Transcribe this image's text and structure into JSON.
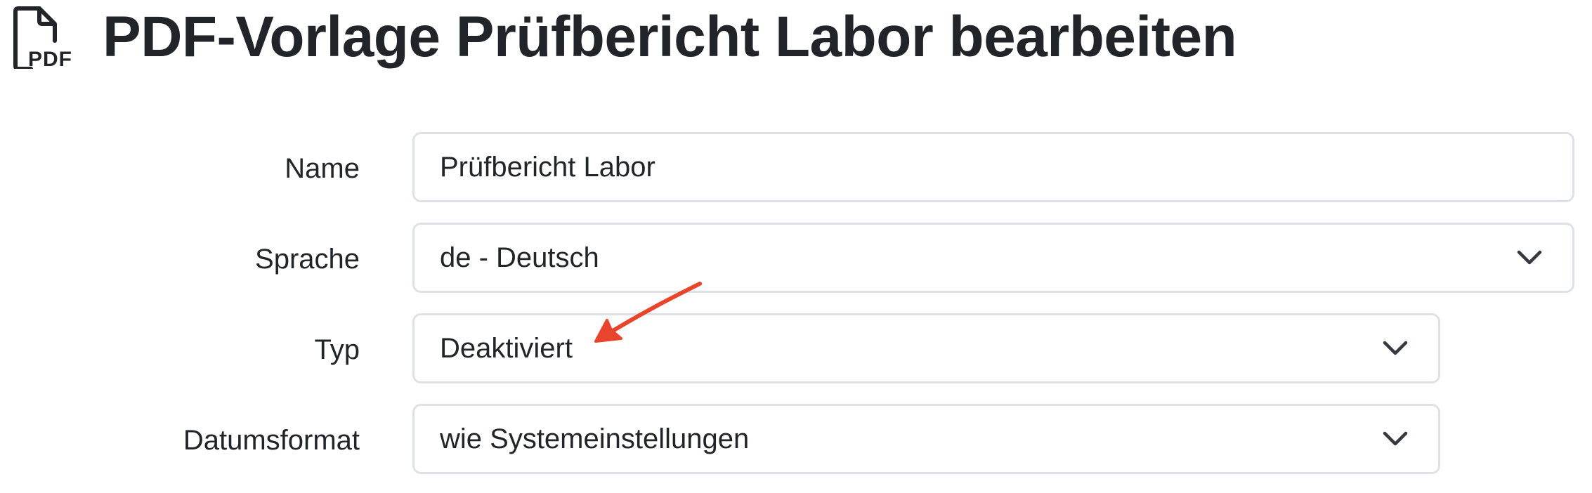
{
  "header": {
    "icon": "pdf-file-icon",
    "title": "PDF-Vorlage Prüfbericht Labor bearbeiten"
  },
  "form": {
    "name": {
      "label": "Name",
      "value": "Prüfbericht Labor"
    },
    "language": {
      "label": "Sprache",
      "selected": "de - Deutsch"
    },
    "type": {
      "label": "Typ",
      "selected": "Deaktiviert"
    },
    "date_format": {
      "label": "Datumsformat",
      "selected": "wie Systemeinstellungen"
    }
  },
  "annotation": {
    "icon": "red-arrow-annotation",
    "color": "#e8452c"
  },
  "colors": {
    "text": "#212529",
    "border": "#dee2e6"
  }
}
